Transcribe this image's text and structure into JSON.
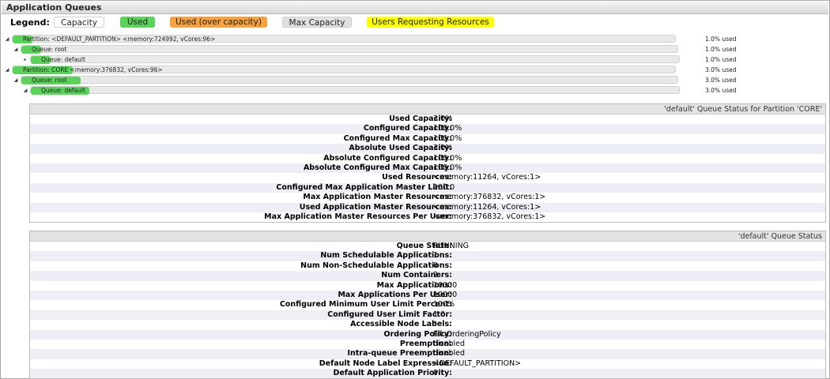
{
  "title": "Application Queues",
  "legend": {
    "label": "Legend:",
    "capacity": "Capacity",
    "used": "Used",
    "over": "Used (over capacity)",
    "max": "Max Capacity",
    "users": "Users Requesting Resources"
  },
  "colors": {
    "used": "#5bd35b",
    "over": "#f6a23d",
    "max": "#e0e0e0",
    "users": "#ffff00"
  },
  "tree": [
    {
      "label": "Partition: <DEFAULT_PARTITION> <memory:724992, vCores:96>",
      "pct": "1.0% used",
      "used_fraction": 0.01
    },
    {
      "label": "Queue: root",
      "pct": "1.0% used",
      "used_fraction": 0.01
    },
    {
      "label": "Queue: default",
      "pct": "1.0% used",
      "used_fraction": 0.01
    },
    {
      "label": "Partition: CORE <memory:376832, vCores:96>",
      "pct": "3.0% used",
      "used_fraction": 0.03
    },
    {
      "label": "Queue: root",
      "pct": "3.0% used",
      "used_fraction": 0.03
    },
    {
      "label": "Queue: default",
      "pct": "3.0% used",
      "used_fraction": 0.03
    }
  ],
  "partition_status": {
    "heading": "'default' Queue Status for Partition 'CORE'",
    "rows": [
      {
        "k": "Used Capacity:",
        "v": "3.0%"
      },
      {
        "k": "Configured Capacity:",
        "v": "100.0%"
      },
      {
        "k": "Configured Max Capacity:",
        "v": "100.0%"
      },
      {
        "k": "Absolute Used Capacity:",
        "v": "3.0%"
      },
      {
        "k": "Absolute Configured Capacity:",
        "v": "100.0%"
      },
      {
        "k": "Absolute Configured Max Capacity:",
        "v": "100.0%"
      },
      {
        "k": "Used Resources:",
        "v": "<memory:11264, vCores:1>"
      },
      {
        "k": "Configured Max Application Master Limit:",
        "v": "100.0"
      },
      {
        "k": "Max Application Master Resources:",
        "v": "<memory:376832, vCores:1>"
      },
      {
        "k": "Used Application Master Resources:",
        "v": "<memory:11264, vCores:1>"
      },
      {
        "k": "Max Application Master Resources Per User:",
        "v": "<memory:376832, vCores:1>"
      }
    ]
  },
  "queue_status": {
    "heading": "'default' Queue Status",
    "rows": [
      {
        "k": "Queue State:",
        "v": "RUNNING"
      },
      {
        "k": "Num Schedulable Applications:",
        "v": "1"
      },
      {
        "k": "Num Non-Schedulable Applications:",
        "v": "0"
      },
      {
        "k": "Num Containers:",
        "v": "2"
      },
      {
        "k": "Max Applications:",
        "v": "10000"
      },
      {
        "k": "Max Applications Per User:",
        "v": "10000"
      },
      {
        "k": "Configured Minimum User Limit Percent:",
        "v": "100%"
      },
      {
        "k": "Configured User Limit Factor:",
        "v": "1.0"
      },
      {
        "k": "Accessible Node Labels:",
        "v": "*"
      },
      {
        "k": "Ordering Policy:",
        "v": "FifoOrderingPolicy"
      },
      {
        "k": "Preemption:",
        "v": "disabled"
      },
      {
        "k": "Intra-queue Preemption:",
        "v": "disabled"
      },
      {
        "k": "Default Node Label Expression:",
        "v": "<DEFAULT_PARTITION>"
      },
      {
        "k": "Default Application Priority:",
        "v": "0"
      }
    ]
  }
}
